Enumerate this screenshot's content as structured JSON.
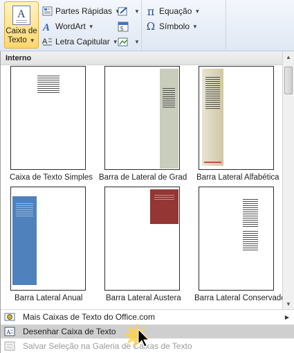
{
  "ribbon": {
    "big_button": {
      "label_line1": "Caixa de",
      "label_line2": "Texto",
      "icon_letter": "A"
    },
    "items": {
      "partes_rapidas": "Partes Rápidas",
      "wordart": "WordArt",
      "letra_capitular": "Letra Capitular",
      "equacao": "Equação",
      "simbolo": "Símbolo"
    },
    "icons": {
      "pi_glyph": "π",
      "omega_glyph": "Ω"
    }
  },
  "gallery": {
    "section_title": "Interno",
    "items": [
      {
        "label": "Caixa de Texto Simples"
      },
      {
        "label": "Barra de Lateral de Grade"
      },
      {
        "label": "Barra Lateral Alfabética"
      },
      {
        "label": "Barra Lateral Anual"
      },
      {
        "label": "Barra Lateral Austera"
      },
      {
        "label": "Barra Lateral Conservadora"
      }
    ]
  },
  "menu": {
    "more_online": "Mais Caixas de Texto do Office.com",
    "draw": "Desenhar Caixa de Texto",
    "save_selection": "Salvar Seleção na Galeria de Caixas de Texto"
  },
  "colors": {
    "accent_selected": "#ffd66b",
    "grade_sidebar": "#c9cdbc",
    "anual_sidebar": "#4f81bd",
    "austera_block": "#943634",
    "hover_row": "#cfcfcf"
  }
}
